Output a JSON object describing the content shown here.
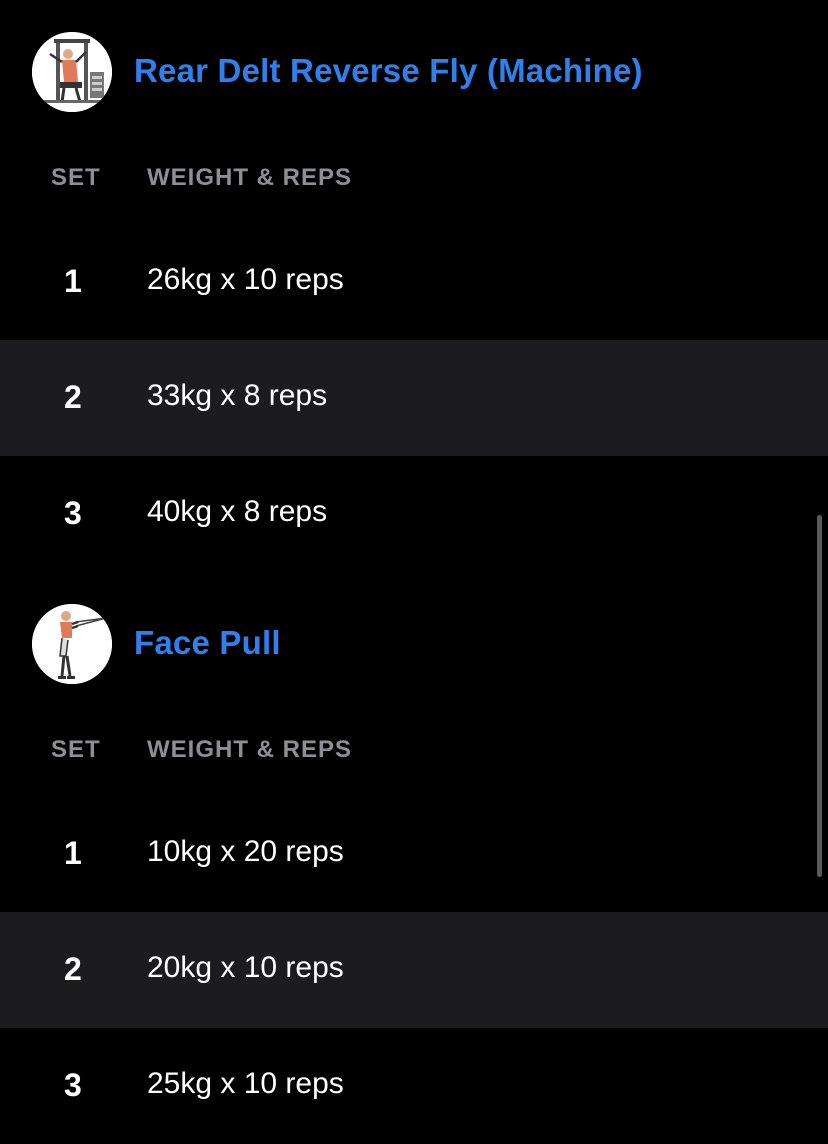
{
  "colors": {
    "background": "#000000",
    "row_shaded": "#1c1c1e",
    "accent": "#2f80ed",
    "header_text": "#8e8e93",
    "text": "#ffffff"
  },
  "exercises": [
    {
      "name": "Rear Delt Reverse Fly (Machine)",
      "thumbnail_icon": "rear-delt-machine-icon",
      "columns": {
        "set": "SET",
        "weight_reps": "WEIGHT & REPS"
      },
      "sets": [
        {
          "number": "1",
          "value": "26kg x 10 reps"
        },
        {
          "number": "2",
          "value": "33kg x 8 reps"
        },
        {
          "number": "3",
          "value": "40kg x 8 reps"
        }
      ]
    },
    {
      "name": "Face Pull",
      "thumbnail_icon": "face-pull-icon",
      "columns": {
        "set": "SET",
        "weight_reps": "WEIGHT & REPS"
      },
      "sets": [
        {
          "number": "1",
          "value": "10kg x 20 reps"
        },
        {
          "number": "2",
          "value": "20kg x 10 reps"
        },
        {
          "number": "3",
          "value": "25kg x 10 reps"
        }
      ]
    }
  ]
}
